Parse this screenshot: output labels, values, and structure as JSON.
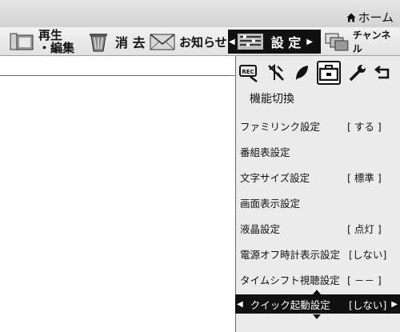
{
  "header": {
    "home_label": "ホーム"
  },
  "menubar": {
    "items": [
      {
        "label_line1": "再生",
        "label_line2": "・編集",
        "icon": "folder-play-icon"
      },
      {
        "label": "消 去",
        "icon": "trash-icon"
      },
      {
        "label": "お知らせ",
        "icon": "envelope-icon"
      },
      {
        "label": "設 定",
        "icon": "settings-bars-icon",
        "selected": true
      },
      {
        "label": "チャンネル",
        "icon": "channel-windows-icon"
      }
    ]
  },
  "settings": {
    "category_icons": [
      "rec-icon",
      "antenna-off-icon",
      "eco-leaf-icon",
      "toolbox-icon",
      "wrench-icon",
      "return-icon"
    ],
    "active_category_index": 3,
    "subtitle": "機能切換",
    "rows": [
      {
        "label": "ファミリンク設定",
        "value": "[ する ]"
      },
      {
        "label": "番組表設定",
        "value": ""
      },
      {
        "label": "文字サイズ設定",
        "value": "[ 標準 ]"
      },
      {
        "label": "画面表示設定",
        "value": ""
      },
      {
        "label": "液晶設定",
        "value": "[ 点灯 ]"
      },
      {
        "label": "電源オフ時計表示設定",
        "value": "[しない]"
      },
      {
        "label": "タイムシフト視聴設定",
        "value": "[ －－ ]"
      },
      {
        "label": "クイック起動設定",
        "value": "[しない]",
        "selected": true
      }
    ]
  }
}
